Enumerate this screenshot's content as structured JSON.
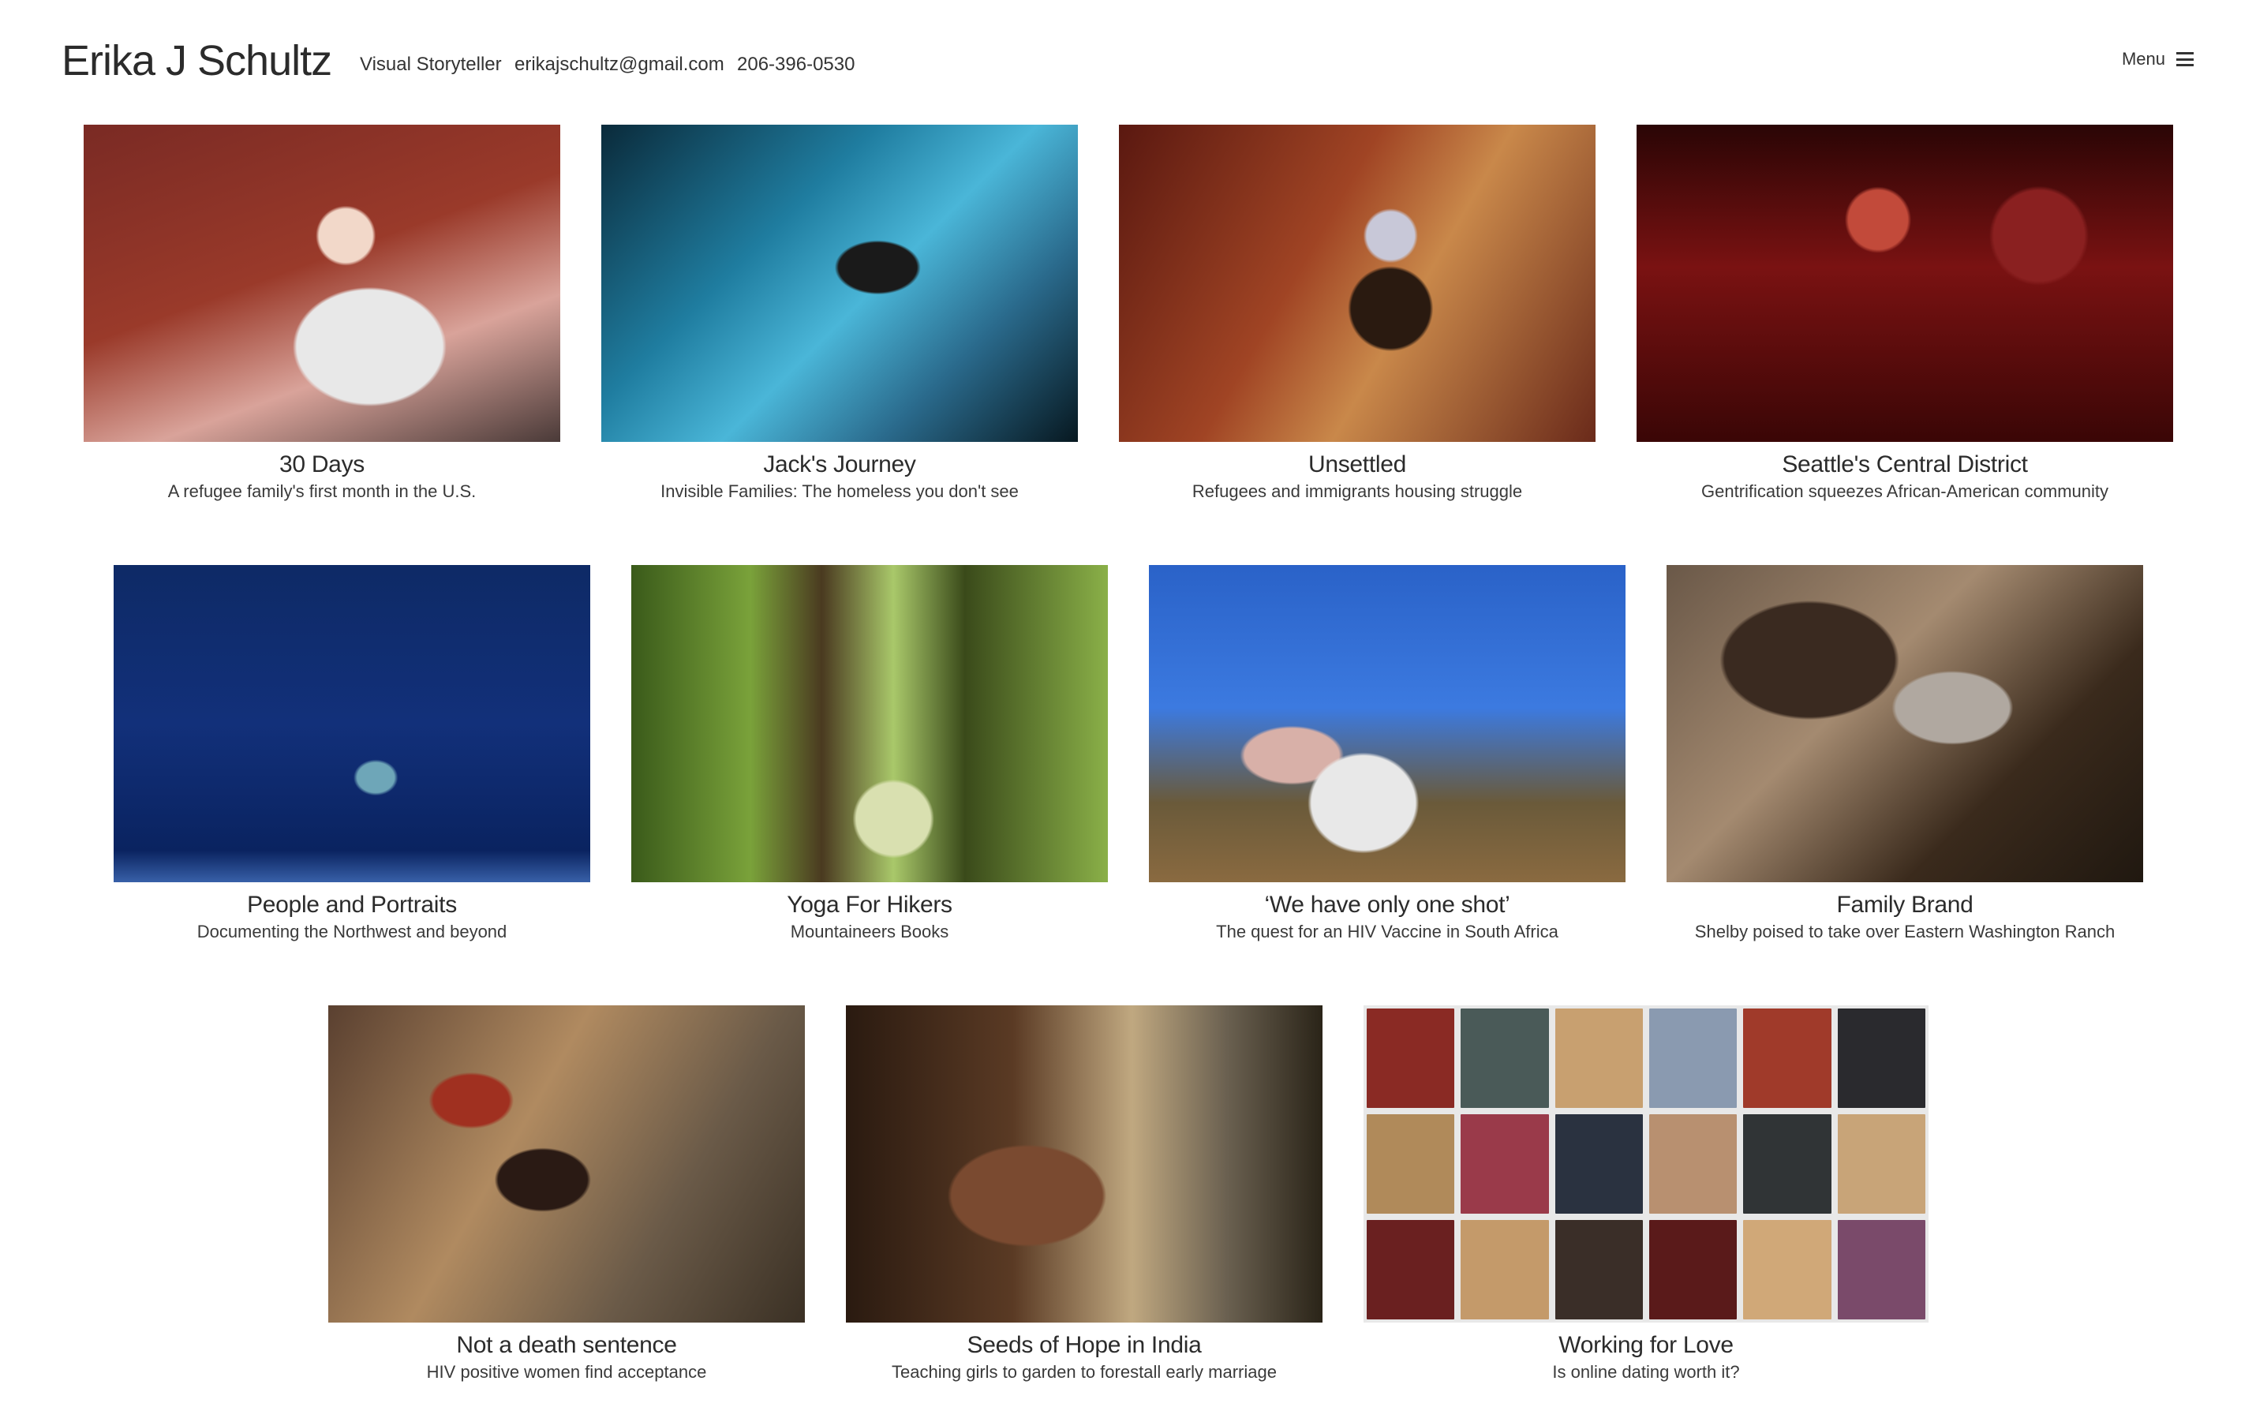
{
  "site": {
    "title": "Erika J Schultz",
    "role": "Visual Storyteller",
    "email": "erikajschultz@gmail.com",
    "phone": "206-396-0530",
    "menu_label": "Menu"
  },
  "projects": [
    {
      "title": "30 Days",
      "subtitle": "A refugee family's first month in the U.S."
    },
    {
      "title": "Jack's Journey",
      "subtitle": "Invisible Families: The homeless you don't see"
    },
    {
      "title": "Unsettled",
      "subtitle": "Refugees and immigrants housing struggle"
    },
    {
      "title": "Seattle's Central District",
      "subtitle": "Gentrification squeezes African-American community"
    },
    {
      "title": "People and Portraits",
      "subtitle": "Documenting the Northwest and beyond"
    },
    {
      "title": "Yoga For Hikers",
      "subtitle": "Mountaineers Books"
    },
    {
      "title": "‘We have only one shot’",
      "subtitle": "The quest for an HIV Vaccine in South Africa"
    },
    {
      "title": "Family Brand",
      "subtitle": "Shelby poised to take over Eastern Washington Ranch"
    },
    {
      "title": "Not a death sentence",
      "subtitle": "HIV positive women find acceptance"
    },
    {
      "title": "Seeds of Hope in India",
      "subtitle": "Teaching girls to garden to forestall early marriage"
    },
    {
      "title": "Working for Love",
      "subtitle": "Is online dating worth it?"
    }
  ]
}
